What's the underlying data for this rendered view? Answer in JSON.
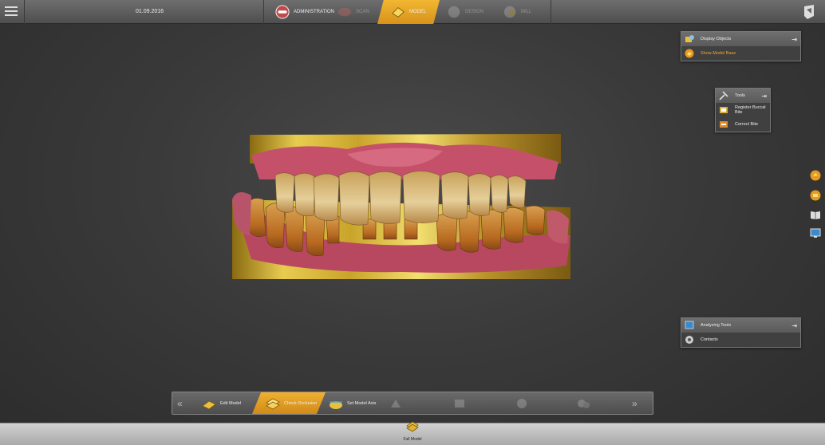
{
  "header": {
    "date": "01.09.2016",
    "steps": [
      {
        "label": "ADMINISTRATION",
        "state": "done"
      },
      {
        "label": "SCAN",
        "state": "disabled"
      },
      {
        "label": "MODEL",
        "state": "active"
      },
      {
        "label": "DESIGN",
        "state": "disabled"
      },
      {
        "label": "MILL",
        "state": "disabled"
      }
    ]
  },
  "panels": {
    "display": {
      "title": "Display Objects",
      "items": [
        {
          "label": "Show Model Base",
          "highlight": true
        }
      ]
    },
    "tools": {
      "title": "Tools",
      "items": [
        {
          "label": "Register Buccal Bite"
        },
        {
          "label": "Correct Bite"
        }
      ]
    },
    "analysis": {
      "title": "Analyzing Tools",
      "items": [
        {
          "label": "Contacts"
        }
      ]
    }
  },
  "side_icons": [
    "model-orange-icon",
    "model-orange-icon-2",
    "book-icon",
    "monitor-icon"
  ],
  "toolbar": {
    "items": [
      {
        "label": "Edit Model",
        "state": "normal"
      },
      {
        "label": "Check Occlusion",
        "state": "active"
      },
      {
        "label": "Set Model Axis",
        "state": "normal"
      },
      {
        "label": "",
        "state": "disabled"
      },
      {
        "label": "",
        "state": "disabled"
      },
      {
        "label": "",
        "state": "disabled"
      },
      {
        "label": "",
        "state": "disabled"
      }
    ],
    "prev": "«",
    "next": "»"
  },
  "footer": {
    "full_model": "Full Model"
  },
  "colors": {
    "accent": "#f0a830",
    "gold": "#d6b430",
    "gum": "#c0506a",
    "tooth": "#d9b882"
  }
}
